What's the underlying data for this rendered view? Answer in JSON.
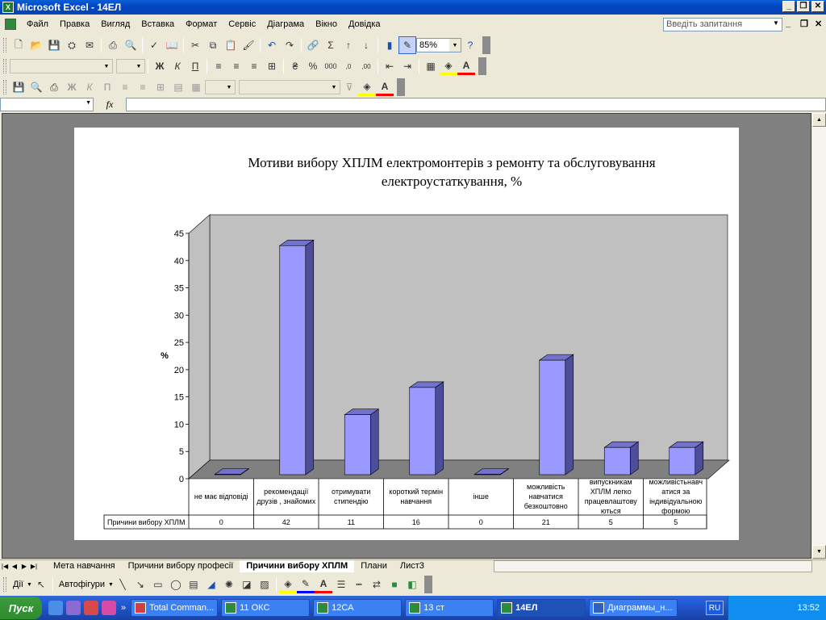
{
  "window": {
    "title": "Microsoft Excel - 14ЕЛ",
    "app_icon": "X"
  },
  "menu": {
    "items": [
      "Файл",
      "Правка",
      "Вигляд",
      "Вставка",
      "Формат",
      "Сервіс",
      "Діаграма",
      "Вікно",
      "Довідка"
    ],
    "ask_placeholder": "Введіть запитання"
  },
  "toolbar": {
    "zoom": "85%"
  },
  "formula": {
    "fx": "fx"
  },
  "chart_data": {
    "type": "bar",
    "title_line1": "Мотиви вибору ХПЛМ електромонтерів з ремонту та обслуговування",
    "title_line2": "електроустаткування, %",
    "ylabel": "%",
    "ylim": [
      0,
      45
    ],
    "yticks": [
      0,
      5,
      10,
      15,
      20,
      25,
      30,
      35,
      40,
      45
    ],
    "categories": [
      [
        "не має відповіді"
      ],
      [
        "рекомендації",
        "друзів , знайомих"
      ],
      [
        "отримувати",
        "стипендію"
      ],
      [
        "короткий термін",
        "навчання"
      ],
      [
        "інше"
      ],
      [
        "можливість",
        "навчатися",
        "безкоштовно"
      ],
      [
        "випускникам",
        "ХПЛМ легко",
        "працевлаштову",
        "ються"
      ],
      [
        "можливістьнавч",
        "атися за",
        "індивідуальною",
        "формою"
      ]
    ],
    "series": [
      {
        "name": "Причини вибору ХПЛМ",
        "values": [
          0,
          42,
          11,
          16,
          0,
          21,
          5,
          5
        ],
        "color": "#9999ff"
      }
    ],
    "table_values": [
      "0",
      "42",
      "11",
      "16",
      "0",
      "21",
      "5",
      "5"
    ],
    "series_label": "Причини вибору ХПЛМ"
  },
  "sheets": {
    "tabs": [
      "Мета навчання",
      "Причини вибору професії",
      "Причини вибору ХПЛМ",
      "Плани",
      "Лист3"
    ],
    "active": "Причини вибору ХПЛМ"
  },
  "drawing": {
    "actions": "Дії",
    "autoshapes": "Автофігури"
  },
  "taskbar": {
    "start": "Пуск",
    "buttons": [
      "Total Comman...",
      "11 ОКС",
      "12СА",
      "13 ст",
      "14ЕЛ",
      "Диаграммы_н..."
    ],
    "active": "14ЕЛ",
    "lang": "RU",
    "time": "13:52"
  }
}
